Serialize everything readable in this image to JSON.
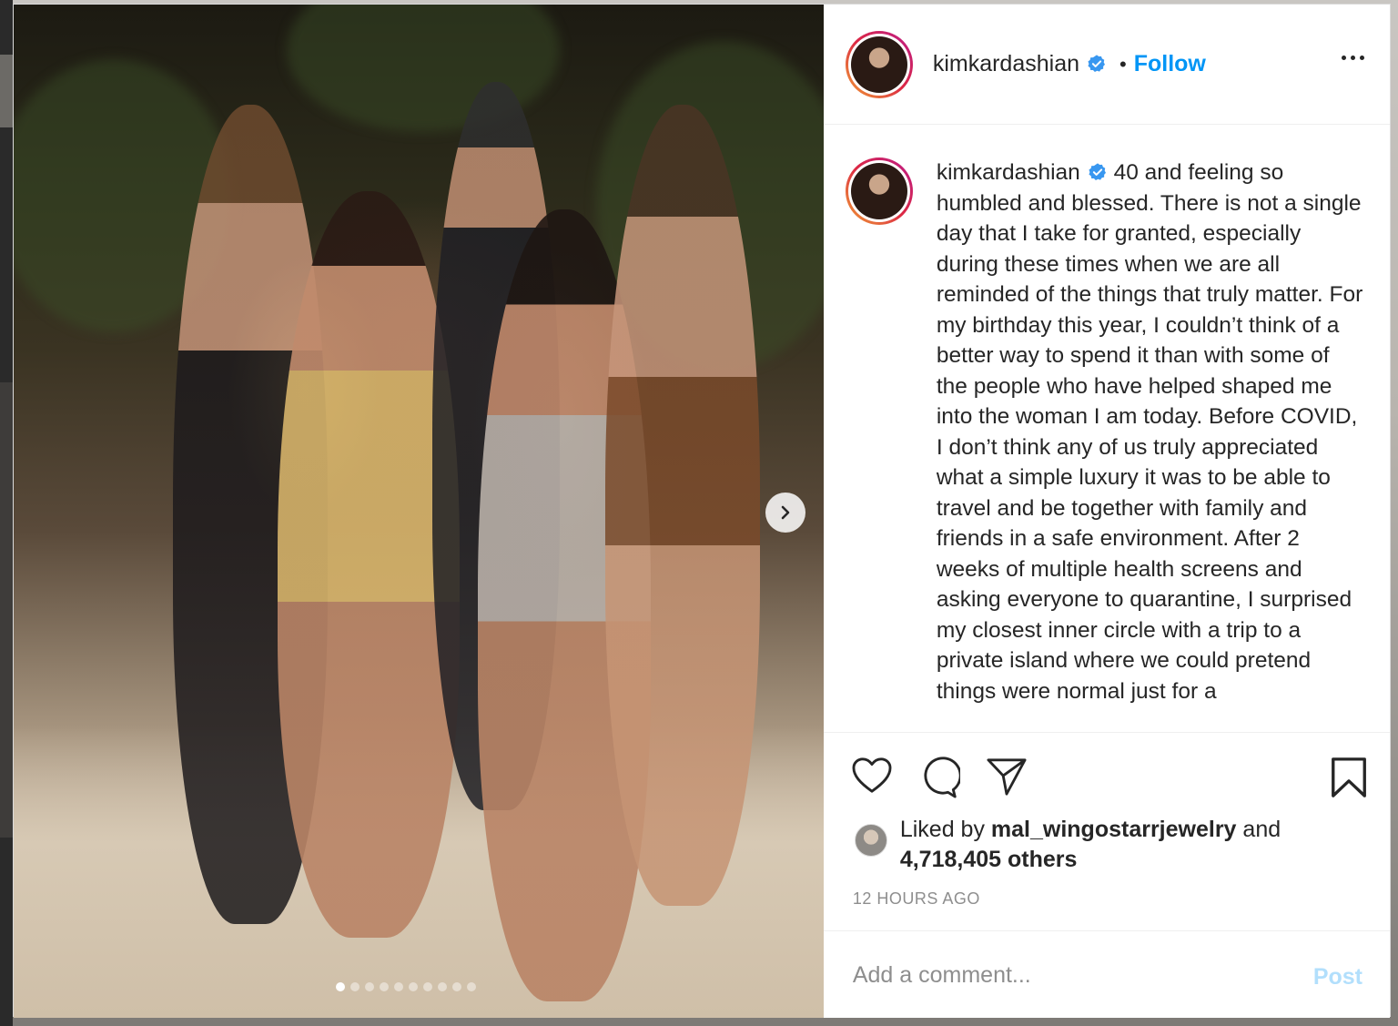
{
  "post": {
    "username": "kimkardashian",
    "verified": true,
    "follow_label": "Follow",
    "separator": "•",
    "caption": "40 and feeling so humbled and blessed. There is not a single day that I take for granted, especially during these times when we are all reminded of the things that truly matter. For my birthday this year, I couldn’t think of a better way to spend it than with some of the people who have helped shaped me into the woman I am today. Before COVID, I don’t think any of us truly appreciated what a simple luxury it was to be able to travel and be together with family and friends in a safe environment. After 2 weeks of multiple health screens and asking everyone to quarantine, I surprised my closest inner circle with a trip to a private island where we could pretend things were normal just for a",
    "likes": {
      "prefix": "Liked by",
      "liker": "mal_wingostarrjewelry",
      "connector": "and",
      "others": "4,718,405 others"
    },
    "timestamp": "12 HOURS AGO",
    "comment": {
      "placeholder": "Add a comment...",
      "post_label": "Post"
    }
  },
  "carousel": {
    "slide_count": 10,
    "active_index": 0
  },
  "icons": {
    "verified": "verified-badge-icon",
    "more": "more-options-icon",
    "like": "heart-icon",
    "comment": "comment-icon",
    "share": "share-icon",
    "save": "bookmark-icon",
    "next": "chevron-right-icon"
  },
  "colors": {
    "accent": "#0095f6",
    "text": "#262626",
    "muted": "#8e8e8e",
    "post_disabled": "#b2dffc"
  }
}
